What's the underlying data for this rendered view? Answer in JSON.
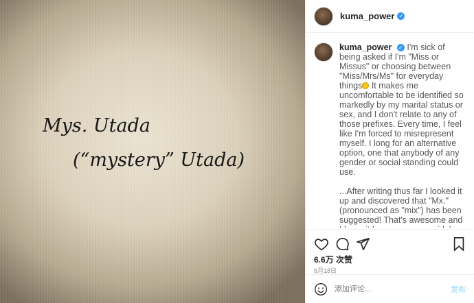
{
  "photo": {
    "line1": "Mys. Utada",
    "line2": "(“mystery” Utada)"
  },
  "header": {
    "username": "kuma_power",
    "verified_icon": "verified-badge-icon"
  },
  "caption": {
    "username": "kuma_power",
    "para1": "I'm sick of being asked if I'm \"Miss or Missus\" or choosing between \"Miss/Mrs/Ms\" for everyday things",
    "para1b": " It makes me uncomfortable to be identified so markedly by my marital status or sex, and I don't relate to any of those prefixes. Every time, I feel like I'm forced to misrepresent myself. I long for an alternative option, one that anybody of any gender or social standing could use.",
    "para2": "...After writing thus far I looked it up and discovered that \"Mx.\" (pronounced as \"mix\") has been suggested! That's awesome and I hope it becomes more widely used. I'm afraid my idea for a neutral prefix has come too late..."
  },
  "actions": {
    "icons": [
      "heart-icon",
      "comment-icon",
      "share-icon",
      "bookmark-icon"
    ],
    "likes": "6.6万 次赞",
    "date": "6月18日"
  },
  "comment_box": {
    "placeholder": "添加评论...",
    "post_label": "发布"
  },
  "colors": {
    "accent": "#3897f0",
    "post_disabled": "#b2dffc",
    "border": "#efefef"
  }
}
